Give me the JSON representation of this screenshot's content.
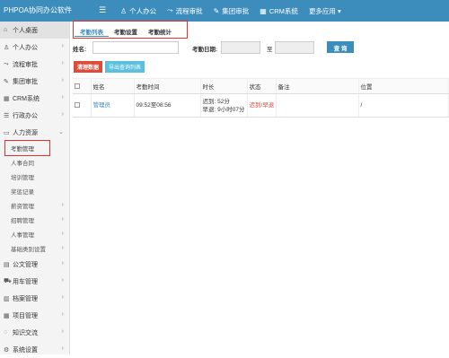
{
  "header": {
    "brand": "PHPOA协同办公软件",
    "menu_icon": "hamburger-icon",
    "nav": [
      {
        "icon": "user-icon",
        "glyph": "♙",
        "label": "个人办公"
      },
      {
        "icon": "flow-icon",
        "glyph": "⤳",
        "label": "流程审批"
      },
      {
        "icon": "edit-icon",
        "glyph": "✎",
        "label": "集团审批"
      },
      {
        "icon": "chart-icon",
        "glyph": "▦",
        "label": "CRM系统"
      },
      {
        "icon": "more-icon",
        "glyph": "",
        "label": "更多应用 ▾"
      }
    ]
  },
  "sidebar": {
    "items": [
      {
        "icon": "home-icon",
        "glyph": "⌂",
        "label": "个人桌面"
      },
      {
        "icon": "user-icon",
        "glyph": "♙",
        "label": "个人办公"
      },
      {
        "icon": "flow-icon",
        "glyph": "⤳",
        "label": "流程审批"
      },
      {
        "icon": "edit-icon",
        "glyph": "✎",
        "label": "集团审批"
      },
      {
        "icon": "chart-icon",
        "glyph": "▦",
        "label": "CRM系统"
      },
      {
        "icon": "list-icon",
        "glyph": "☰",
        "label": "行政办公"
      },
      {
        "icon": "book-icon",
        "glyph": "▭",
        "label": "人力资源"
      }
    ],
    "hr_sub": [
      {
        "label": "考勤管理"
      },
      {
        "label": "人事合同"
      },
      {
        "label": "培训管理"
      },
      {
        "label": "奖惩记录"
      },
      {
        "label": "薪资管理"
      },
      {
        "label": "招聘管理"
      },
      {
        "label": "人事管理"
      },
      {
        "label": "基础类别设置"
      }
    ],
    "bottom": [
      {
        "icon": "doc-icon",
        "glyph": "▤",
        "label": "公文管理"
      },
      {
        "icon": "car-icon",
        "glyph": "⛟",
        "label": "用车管理"
      },
      {
        "icon": "archive-icon",
        "glyph": "▥",
        "label": "档案管理"
      },
      {
        "icon": "project-icon",
        "glyph": "▦",
        "label": "项目管理"
      },
      {
        "icon": "chat-icon",
        "glyph": "◌",
        "label": "知识交流"
      },
      {
        "icon": "settings-icon",
        "glyph": "⚙",
        "label": "系统设置"
      }
    ]
  },
  "tabs": [
    "考勤列表",
    "考勤设置",
    "考勤统计"
  ],
  "filter": {
    "name_label": "姓名:",
    "name_value": "",
    "date_label": "考勤日期:",
    "date_from": "",
    "to_label": "至",
    "date_to": "",
    "search_button": "查 询"
  },
  "actions": {
    "clear": "清理数据",
    "export": "导出查询列表"
  },
  "table": {
    "headers": [
      "",
      "姓名",
      "考勤时间",
      "时长",
      "状态",
      "备注",
      "位置"
    ],
    "rows": [
      {
        "name": "管理员",
        "time": "09:52至08:56",
        "duration_line1": "迟到: 52分",
        "duration_line2": "早退: 9小时07分",
        "status": "迟到/早退",
        "remark": "",
        "location": "/"
      }
    ]
  }
}
